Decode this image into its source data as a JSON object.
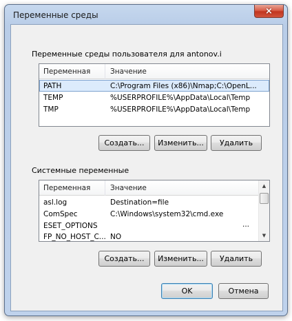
{
  "window": {
    "title": "Переменные среды",
    "close_label": "×"
  },
  "user_vars": {
    "group_label": "Переменные среды пользователя для antonov.i",
    "columns": [
      "Переменная",
      "Значение"
    ],
    "rows": [
      {
        "name": "PATH",
        "value": "C:\\Program Files (x86)\\Nmap;C:\\OpenL..."
      },
      {
        "name": "TEMP",
        "value": "%USERPROFILE%\\AppData\\Local\\Temp"
      },
      {
        "name": "TMP",
        "value": "%USERPROFILE%\\AppData\\Local\\Temp"
      }
    ],
    "buttons": {
      "create": "Создать...",
      "edit": "Изменить...",
      "delete": "Удалить"
    }
  },
  "system_vars": {
    "group_label": "Системные переменные",
    "columns": [
      "Переменная",
      "Значение"
    ],
    "rows": [
      {
        "name": "asl.log",
        "value": "Destination=file"
      },
      {
        "name": "ComSpec",
        "value": "C:\\Windows\\system32\\cmd.exe"
      },
      {
        "name": "ESET_OPTIONS",
        "value": "..."
      },
      {
        "name": "FP_NO_HOST_C...",
        "value": "NO"
      }
    ],
    "buttons": {
      "create": "Создать...",
      "edit": "Изменить...",
      "delete": "Удалить"
    }
  },
  "dialog_buttons": {
    "ok": "OK",
    "cancel": "Отмена"
  },
  "colors": {
    "selected_row": "#dcebfc",
    "close_button": "#c7402a"
  }
}
